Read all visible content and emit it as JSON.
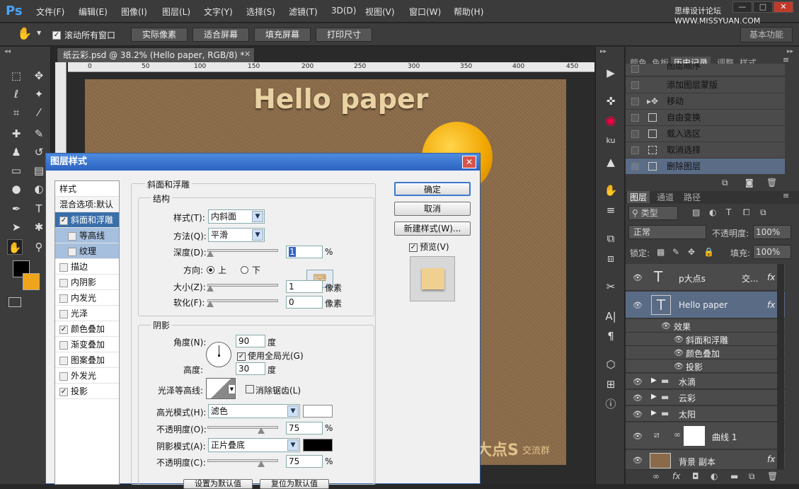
{
  "app": {
    "logo": "Ps"
  },
  "menu": [
    "文件(F)",
    "编辑(E)",
    "图像(I)",
    "图层(L)",
    "文字(Y)",
    "选择(S)",
    "滤镜(T)",
    "3D(D)",
    "视图(V)",
    "窗口(W)",
    "帮助(H)"
  ],
  "watermark": "思缘设计论坛 WWW.MISSYUAN.COM",
  "window_buttons": [
    "—",
    "□",
    "✕"
  ],
  "options": {
    "scroll_all": "滚动所有窗口",
    "buttons": [
      "实际像素",
      "适合屏幕",
      "填充屏幕",
      "打印尺寸"
    ],
    "workspace": "基本功能"
  },
  "document": {
    "tab": "纸云彩.psd @ 38.2% (Hello paper, RGB/8) *",
    "ruler_ticks": [
      "0",
      "50",
      "100",
      "150",
      "200",
      "250",
      "300",
      "350",
      "400",
      "450"
    ],
    "headline": "Hello paper",
    "footer_big": "大点S",
    "footer_small": "交流群"
  },
  "panel_tabs": [
    "颜色",
    "色板",
    "历史记录",
    "调整",
    "样式"
  ],
  "history": [
    "图层顺序",
    "添加图层蒙版",
    "移动",
    "自由变换",
    "载入选区",
    "取消选择",
    "删除图层"
  ],
  "layers_panel": {
    "tabs": [
      "图层",
      "通道",
      "路径"
    ],
    "filter_label": "类型",
    "blend_mode": "正常",
    "opacity_label": "不透明度:",
    "opacity_value": "100%",
    "lock_label": "锁定:",
    "fill_label": "填充:",
    "fill_value": "100%",
    "layers": [
      {
        "name": "p大点s",
        "extra": "交..."
      },
      {
        "name": "Hello paper"
      },
      {
        "name": "效果"
      },
      {
        "name": "斜面和浮雕"
      },
      {
        "name": "颜色叠加"
      },
      {
        "name": "投影"
      },
      {
        "name": "水滴"
      },
      {
        "name": "云彩"
      },
      {
        "name": "太阳"
      },
      {
        "name": "曲线 1"
      },
      {
        "name": "背景 副本"
      }
    ]
  },
  "dialog": {
    "title": "图层样式",
    "styles_header": "样式",
    "blend_default": "混合选项:默认",
    "styles": [
      {
        "label": "斜面和浮雕",
        "checked": true
      },
      {
        "label": "等高线",
        "checked": false
      },
      {
        "label": "纹理",
        "checked": false
      },
      {
        "label": "描边",
        "checked": false
      },
      {
        "label": "内阴影",
        "checked": false
      },
      {
        "label": "内发光",
        "checked": false
      },
      {
        "label": "光泽",
        "checked": false
      },
      {
        "label": "颜色叠加",
        "checked": true
      },
      {
        "label": "渐变叠加",
        "checked": false
      },
      {
        "label": "图案叠加",
        "checked": false
      },
      {
        "label": "外发光",
        "checked": false
      },
      {
        "label": "投影",
        "checked": true
      }
    ],
    "bevel": {
      "section": "斜面和浮雕",
      "structure": "结构",
      "style_label": "样式(T):",
      "style_value": "内斜面",
      "method_label": "方法(Q):",
      "method_value": "平滑",
      "depth_label": "深度(D):",
      "depth_value": "1",
      "depth_unit": "%",
      "direction_label": "方向:",
      "dir_up": "上",
      "dir_down": "下",
      "size_label": "大小(Z):",
      "size_value": "1",
      "size_unit": "像素",
      "soften_label": "软化(F):",
      "soften_value": "0",
      "soften_unit": "像素"
    },
    "shading": {
      "section": "阴影",
      "angle_label": "角度(N):",
      "angle_value": "90",
      "angle_unit": "度",
      "global_light": "使用全局光(G)",
      "altitude_label": "高度:",
      "altitude_value": "30",
      "altitude_unit": "度",
      "gloss_label": "光泽等高线:",
      "antialias": "消除锯齿(L)",
      "highlight_label": "高光模式(H):",
      "highlight_value": "滤色",
      "hl_opacity_label": "不透明度(O):",
      "hl_opacity_value": "75",
      "hl_unit": "%",
      "shadow_label": "阴影模式(A):",
      "shadow_value": "正片叠底",
      "sh_opacity_label": "不透明度(C):",
      "sh_opacity_value": "75",
      "sh_unit": "%",
      "set_default": "设置为默认值",
      "reset_default": "复位为默认值"
    },
    "buttons": {
      "ok": "确定",
      "cancel": "取消",
      "new_style": "新建样式(W)...",
      "preview": "预览(V)"
    }
  }
}
